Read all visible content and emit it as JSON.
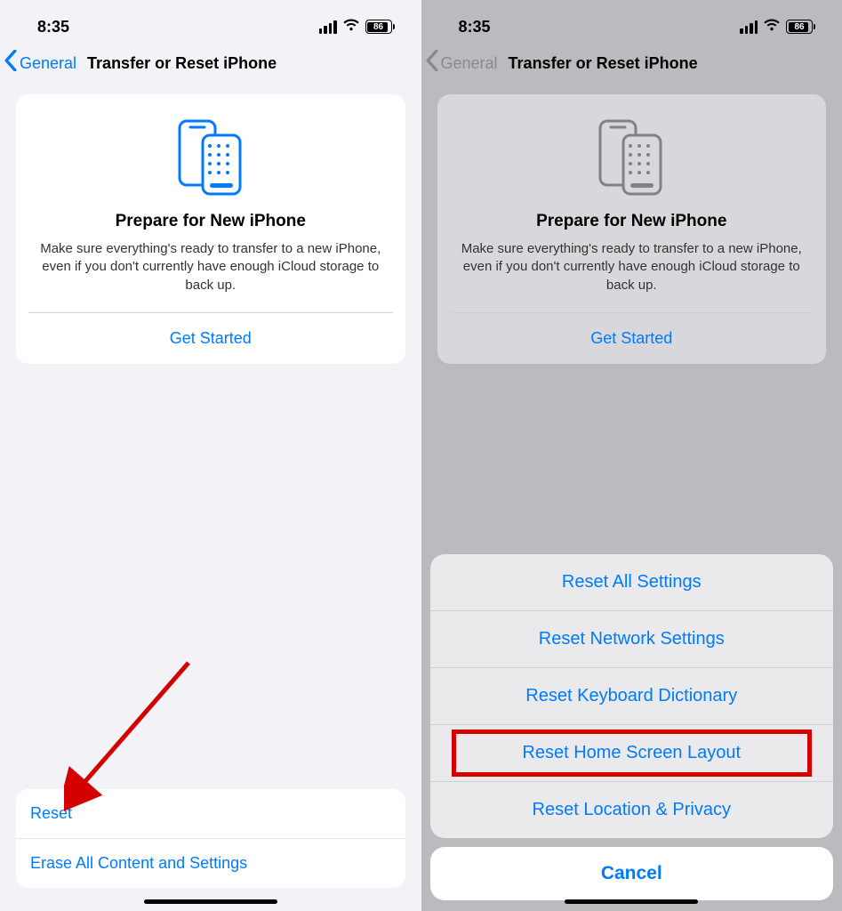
{
  "status": {
    "time": "8:35",
    "battery_pct": "86"
  },
  "nav": {
    "back_label": "General",
    "title": "Transfer or Reset iPhone"
  },
  "card": {
    "heading": "Prepare for New iPhone",
    "body": "Make sure everything's ready to transfer to a new iPhone, even if you don't currently have enough iCloud storage to back up.",
    "action": "Get Started"
  },
  "rows": {
    "reset": "Reset",
    "erase": "Erase All Content and Settings"
  },
  "sheet": {
    "options": [
      "Reset All Settings",
      "Reset Network Settings",
      "Reset Keyboard Dictionary",
      "Reset Home Screen Layout",
      "Reset Location & Privacy"
    ],
    "cancel": "Cancel",
    "highlight_index": 3
  },
  "colors": {
    "accent": "#007aff"
  }
}
